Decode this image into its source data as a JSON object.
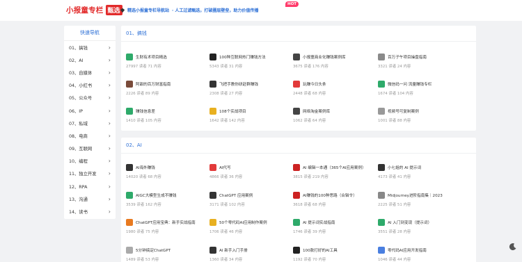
{
  "header": {
    "logo_text": "小报童专栏",
    "logo_badge": "甄选",
    "notice_a": "精选小报童专栏导航站",
    "hot_badge": "HOT",
    "notice_b": "· 人工过滤甄选，打破圈层壁垒，助力价值传播"
  },
  "sidebar": {
    "title": "快速导航",
    "items": [
      {
        "label": "01、搞钱"
      },
      {
        "label": "02、AI"
      },
      {
        "label": "03、自媒体"
      },
      {
        "label": "04、小红书"
      },
      {
        "label": "05、公众号"
      },
      {
        "label": "06、IP"
      },
      {
        "label": "07、私域"
      },
      {
        "label": "08、电商"
      },
      {
        "label": "09、互联网"
      },
      {
        "label": "10、编程"
      },
      {
        "label": "11、独立开发"
      },
      {
        "label": "12、RPA"
      },
      {
        "label": "13、沟通"
      },
      {
        "label": "14、读书"
      }
    ]
  },
  "sections": [
    {
      "title": "01、搞钱",
      "cards": [
        {
          "title": "生财有术项目精选",
          "meta": "27997 读者 71 内容",
          "icon_color": "#2eaa6a",
          "icon": "generic-icon"
        },
        {
          "title": "100种互联网热门赚钱方法",
          "meta": "5343 读者 31 内容",
          "icon_color": "#222222",
          "icon": "generic-icon"
        },
        {
          "title": "小报童商业化赚钱案例库",
          "meta": "3675 读者 176 内容",
          "icon_color": "#444444",
          "icon": "generic-icon"
        },
        {
          "title": "百万子午项目操盘指南",
          "meta": "3321 读者 24 内容",
          "icon_color": "#8a8a8a",
          "icon": "avatar-icon"
        },
        {
          "title": "阿甜的百万财富指南",
          "meta": "2226 读者 89 内容",
          "icon_color": "#7a4b3a",
          "icon": "avatar-icon"
        },
        {
          "title": "飞把手教你研赶群赚钱",
          "meta": "2308 读者 27 内容",
          "icon_color": "#333333",
          "icon": "generic-icon"
        },
        {
          "title": "玩赚今日头条",
          "meta": "2448 读者 68 内容",
          "icon_color": "#e23a3a",
          "icon": "generic-icon"
        },
        {
          "title": "微信码一问 流量赚钱专栏",
          "meta": "1674 读者 104 内容",
          "icon_color": "#2eaa6a",
          "icon": "generic-icon"
        },
        {
          "title": "赚钱信息差",
          "meta": "1410 读者 105 内容",
          "icon_color": "#2eaa6a",
          "icon": "generic-icon"
        },
        {
          "title": "108个实战项目",
          "meta": "1642 读者 142 内容",
          "icon_color": "#e8b020",
          "icon": "generic-icon"
        },
        {
          "title": "网络淘金案例库",
          "meta": "1062 读者 64 内容",
          "icon_color": "#444444",
          "icon": "generic-icon"
        },
        {
          "title": "视频号可复制案例",
          "meta": "1001 读者 88 内容",
          "icon_color": "#999999",
          "icon": "avatar-icon"
        }
      ]
    },
    {
      "title": "02、AI",
      "cards": [
        {
          "title": "AI海外赚钱",
          "meta": "14020 读者 68 内容",
          "icon_color": "#333333",
          "icon": "generic-icon"
        },
        {
          "title": "AI代写",
          "meta": "4866 读者 36 内容",
          "icon_color": "#e23a3a",
          "icon": "generic-icon"
        },
        {
          "title": "AI 编辑一本通（365个AI应用案例）",
          "meta": "3815 读者 219 内容",
          "icon_color": "#cc2222",
          "icon": "generic-icon"
        },
        {
          "title": "小七姐的 AI 提示词",
          "meta": "4173 读者 41 内容",
          "icon_color": "#333333",
          "icon": "generic-icon"
        },
        {
          "title": "AIGC大模型生成不赚钱",
          "meta": "3539 读者 162 内容",
          "icon_color": "#2eaa6a",
          "icon": "generic-icon"
        },
        {
          "title": "ChatGPT 应用案例",
          "meta": "3171 读者 102 内容",
          "icon_color": "#333333",
          "icon": "generic-icon"
        },
        {
          "title": "AI赚钱的100种思路（合辑令）",
          "meta": "3618 读者 68 内容",
          "icon_color": "#cc2222",
          "icon": "generic-icon"
        },
        {
          "title": "Midjourney进阶指南集｜2023",
          "meta": "2225 读者 51 内容",
          "icon_color": "#888888",
          "icon": "avatar-icon"
        },
        {
          "title": "ChatGPT应用宝典：新手实战指南",
          "meta": "1980 读者 75 内容",
          "icon_color": "#e87a20",
          "icon": "generic-icon"
        },
        {
          "title": "50个零代码AI应用制作案例",
          "meta": "1706 读者 46 内容",
          "icon_color": "#e8b020",
          "icon": "generic-icon"
        },
        {
          "title": "AI 提示词实战指南",
          "meta": "1746 读者 39 内容",
          "icon_color": "#2eaa6a",
          "icon": "generic-icon"
        },
        {
          "title": "AI 入门到变现（提示词）",
          "meta": "3551 读者 28 内容",
          "icon_color": "#2eaa6a",
          "icon": "generic-icon"
        },
        {
          "title": "5分钟搞定ChatGPT",
          "meta": "1489 读者 53 内容",
          "icon_color": "#aaaaaa",
          "icon": "generic-icon"
        },
        {
          "title": "AI 新手入门手册",
          "meta": "1360 读者 34 内容",
          "icon_color": "#333333",
          "icon": "generic-icon"
        },
        {
          "title": "100款打好的AI工具",
          "meta": "1192 读者 70 内容",
          "icon_color": "#222222",
          "icon": "generic-icon"
        },
        {
          "title": "零代码AI应用开发指南",
          "meta": "1046 读者 44 内容",
          "icon_color": "#4a7fe0",
          "icon": "generic-icon"
        }
      ]
    }
  ]
}
